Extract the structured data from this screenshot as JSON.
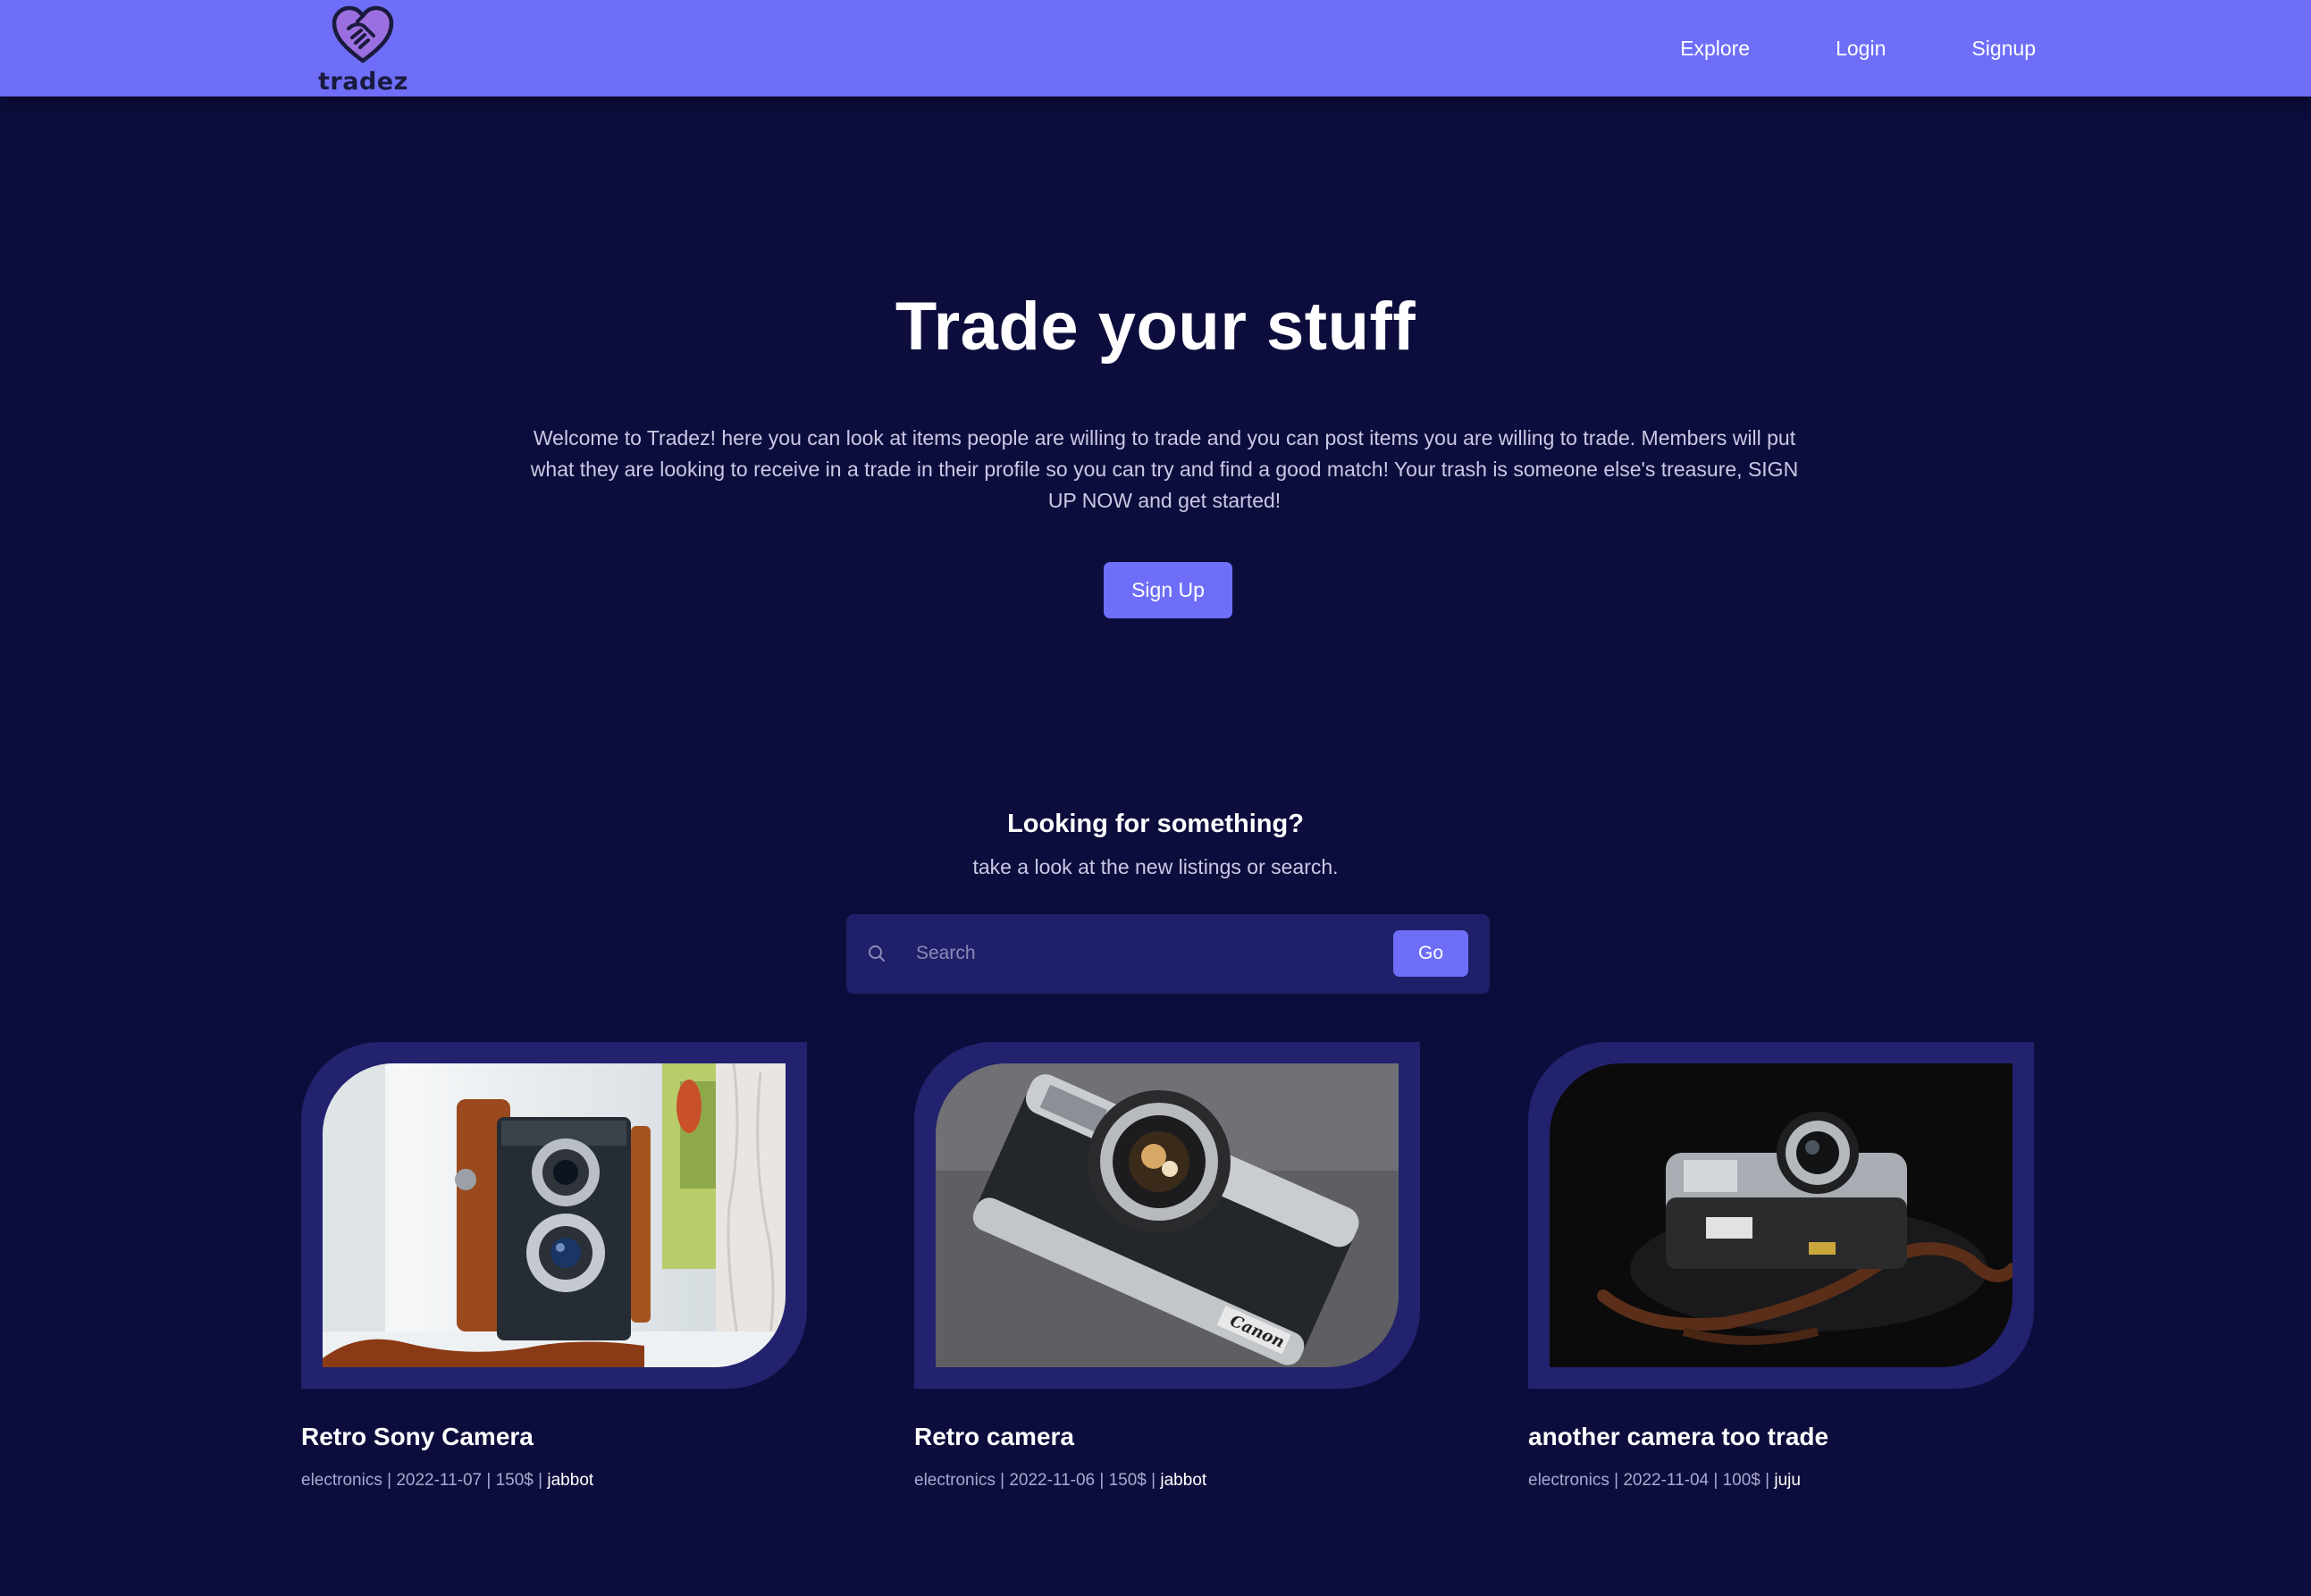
{
  "brand": {
    "name": "tradez",
    "logo_icon": "heart-handshake-icon",
    "accent": "#6e6ef9",
    "background": "#0d0d3d"
  },
  "nav": {
    "links": [
      "Explore",
      "Login",
      "Signup"
    ]
  },
  "hero": {
    "title": "Trade your stuff",
    "text": "Welcome to Tradez! here you can look at items people are willing to trade and you can post items you are willing to trade. Members will put what they are looking to receive in a trade in their profile so you can try and find a good match! Your trash is someone else's treasure, SIGN UP NOW and get started!",
    "button": "Sign Up"
  },
  "search": {
    "heading": "Looking for something?",
    "subheading": "take a look at the new listings or search.",
    "placeholder": "Search",
    "button": "Go"
  },
  "listings": [
    {
      "title": "Retro Sony Camera",
      "category": "electronics",
      "date": "2022-11-07",
      "price": "150$",
      "user": "jabbot"
    },
    {
      "title": "Retro camera",
      "category": "electronics",
      "date": "2022-11-06",
      "price": "150$",
      "user": "jabbot"
    },
    {
      "title": "another camera too trade",
      "category": "electronics",
      "date": "2022-11-04",
      "price": "100$",
      "user": "juju"
    }
  ]
}
